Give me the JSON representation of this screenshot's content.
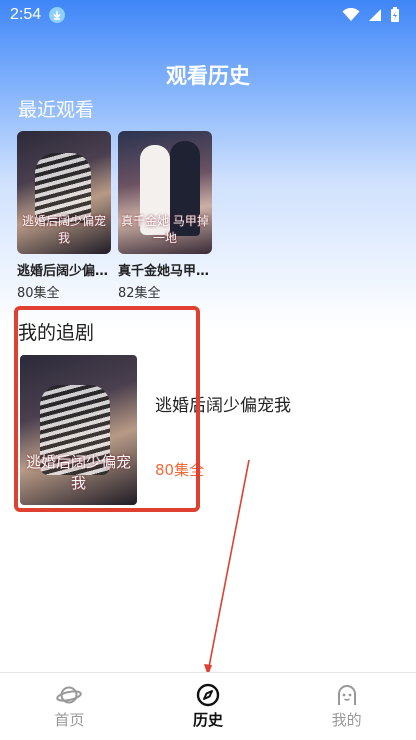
{
  "status_bar": {
    "time": "2:54"
  },
  "page": {
    "title": "观看历史"
  },
  "recent": {
    "title": "最近观看",
    "items": [
      {
        "name": "逃婚后阔少偏宠我",
        "count": "80集全",
        "poster_caption": "逃婚后阔少偏宠我"
      },
      {
        "name": "真千金她马甲掉一地",
        "count": "82集全",
        "poster_caption": "真千金她 马甲掉一地"
      }
    ]
  },
  "follow": {
    "title": "我的追剧",
    "item": {
      "name": "逃婚后阔少偏宠我",
      "count": "80集全",
      "poster_caption": "逃婚后阔少偏宠我"
    }
  },
  "nav": {
    "items": [
      {
        "label": "首页",
        "icon": "planet-icon"
      },
      {
        "label": "历史",
        "icon": "compass-icon"
      },
      {
        "label": "我的",
        "icon": "face-icon"
      }
    ]
  },
  "colors": {
    "accent": "#3f86f8",
    "annotation": "#e0402f",
    "count_highlight": "#f06a3a"
  }
}
